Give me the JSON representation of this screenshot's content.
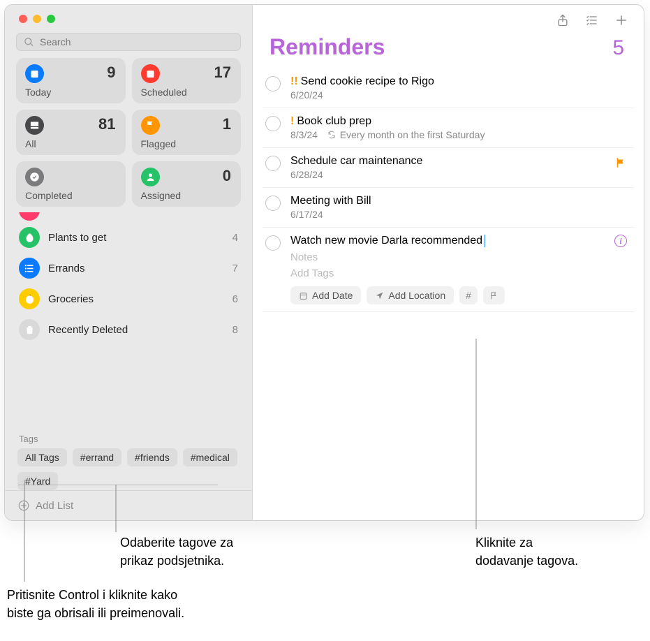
{
  "search": {
    "placeholder": "Search"
  },
  "smart": [
    {
      "key": "today",
      "label": "Today",
      "count": 9,
      "bg": "#0a7aff",
      "icon": "calendar"
    },
    {
      "key": "scheduled",
      "label": "Scheduled",
      "count": 17,
      "bg": "#ff3b30",
      "icon": "calendar"
    },
    {
      "key": "all",
      "label": "All",
      "count": 81,
      "bg": "#48484a",
      "icon": "tray"
    },
    {
      "key": "flagged",
      "label": "Flagged",
      "count": 1,
      "bg": "#ff9500",
      "icon": "flag"
    },
    {
      "key": "completed",
      "label": "Completed",
      "count": "",
      "bg": "#7b7b7d",
      "icon": "check"
    },
    {
      "key": "assigned",
      "label": "Assigned",
      "count": 0,
      "bg": "#26c267",
      "icon": "person"
    }
  ],
  "lists": [
    {
      "name": "Plants to get",
      "count": 4,
      "bg": "#26c267",
      "icon": "leaf"
    },
    {
      "name": "Errands",
      "count": 7,
      "bg": "#0a7aff",
      "icon": "list"
    },
    {
      "name": "Groceries",
      "count": 6,
      "bg": "#ffcc00",
      "icon": "lemon"
    },
    {
      "name": "Recently Deleted",
      "count": 8,
      "bg": "#d9d9d9",
      "icon": "trash",
      "fg": "#8a8a8a"
    }
  ],
  "tagsHeader": "Tags",
  "tags": [
    "All Tags",
    "#errand",
    "#friends",
    "#medical",
    "#Yard"
  ],
  "addList": "Add List",
  "title": "Reminders",
  "count": 5,
  "items": [
    {
      "priority": "!!",
      "title": "Send cookie recipe to Rigo",
      "meta": "6/20/24"
    },
    {
      "priority": "!",
      "title": "Book club prep",
      "meta": "8/3/24",
      "repeat": "Every month on the first Saturday"
    },
    {
      "title": "Schedule car maintenance",
      "meta": "6/28/24",
      "flag": true
    },
    {
      "title": "Meeting with Bill",
      "meta": "6/17/24"
    },
    {
      "title": "Watch new movie Darla recommended",
      "editing": true,
      "notesPh": "Notes",
      "tagsPh": "Add Tags",
      "addDate": "Add Date",
      "addLoc": "Add Location"
    }
  ],
  "callouts": {
    "tagsSelect": "Odaberite tagove za\nprikaz podsjetnika.",
    "addTags": "Kliknite za\ndodavanje tagova.",
    "ctrlClick": "Pritisnite Control i kliknite kako\nbiste ga obrisali ili preimenovali."
  }
}
